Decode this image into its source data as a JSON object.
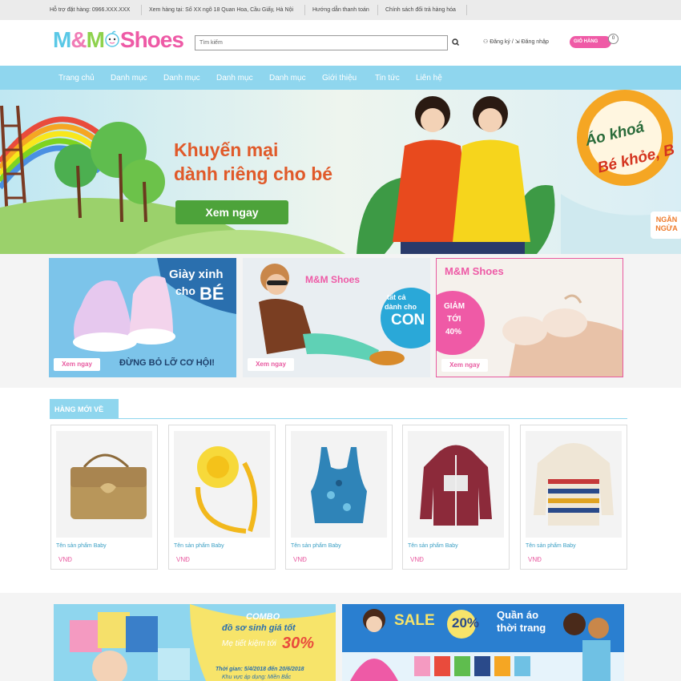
{
  "topbar": {
    "hotline": "Hỗ trợ đặt hàng: 0966.XXX.XXX",
    "address": "Xem hàng tại: Số XX ngõ 18 Quan Hoa, Cầu Giấy, Hà Nội",
    "payment": "Hướng dẫn thanh toán",
    "policy": "Chính sách đổi trả hàng hóa"
  },
  "header": {
    "logo": {
      "part1": "M",
      "amp": "&",
      "part2": "M",
      "shoes": "Shoes"
    },
    "search_placeholder": "Tìm kiếm",
    "register": "Đăng ký",
    "divider": "/",
    "login": "Đăng nhập",
    "cart_label": "GIỎ HÀNG",
    "cart_count": "0"
  },
  "nav": {
    "items": [
      "Trang chủ",
      "Danh mục",
      "Danh mục",
      "Danh mục",
      "Danh mục",
      "Giới thiệu",
      "Tin tức",
      "Liên hệ"
    ]
  },
  "hero": {
    "line1": "Khuyến mại",
    "line2": "dành riêng cho bé",
    "button": "Xem ngay",
    "side_line1": "Áo khoá",
    "side_line2": "Bé khỏe, B",
    "side_badge_line1": "NGĂN",
    "side_badge_line2": "NGỪA"
  },
  "promos": [
    {
      "heading1": "Giày xinh",
      "heading2": "cho",
      "heading3": "BÉ",
      "tagline": "ĐỪNG BỎ LỠ CƠ HỘI!",
      "button": "Xem ngay"
    },
    {
      "logo": "M&M Shoes",
      "heading1": "tất cả",
      "heading2": "dành cho",
      "heading3": "CON",
      "button": "Xem ngay"
    },
    {
      "logo": "M&M Shoes",
      "heading1": "GIẢM",
      "heading2": "TỚI",
      "heading3": "40%",
      "button": "Xem ngay"
    }
  ],
  "new_arrivals": {
    "title": "HÀNG MỚI VỀ",
    "products": [
      {
        "name": "Tên sản phẩm Baby",
        "price": "VNĐ"
      },
      {
        "name": "Tên sản phẩm Baby",
        "price": "VNĐ"
      },
      {
        "name": "Tên sản phẩm Baby",
        "price": "VNĐ"
      },
      {
        "name": "Tên sản phẩm Baby",
        "price": "VNĐ"
      },
      {
        "name": "Tên sản phẩm Baby",
        "price": "VNĐ"
      }
    ]
  },
  "bottom_banners": [
    {
      "line1": "COMBO",
      "line2": "đồ sơ sinh giá tốt",
      "line3": "Mẹ tiết kiệm tới",
      "line4": "30%",
      "line5": "Thời gian: 5/4/2018 đến 20/6/2018",
      "line6": "Khu vực áp dụng: Miền Bắc"
    },
    {
      "sale": "SALE",
      "percent": "20%",
      "line1": "Quần áo",
      "line2": "thời trang"
    }
  ],
  "colors": {
    "nav_bg": "#8fd6ee",
    "accent_pink": "#ef5aa6",
    "link_blue": "#3a9fc4",
    "hero_green": "#4da33a"
  }
}
